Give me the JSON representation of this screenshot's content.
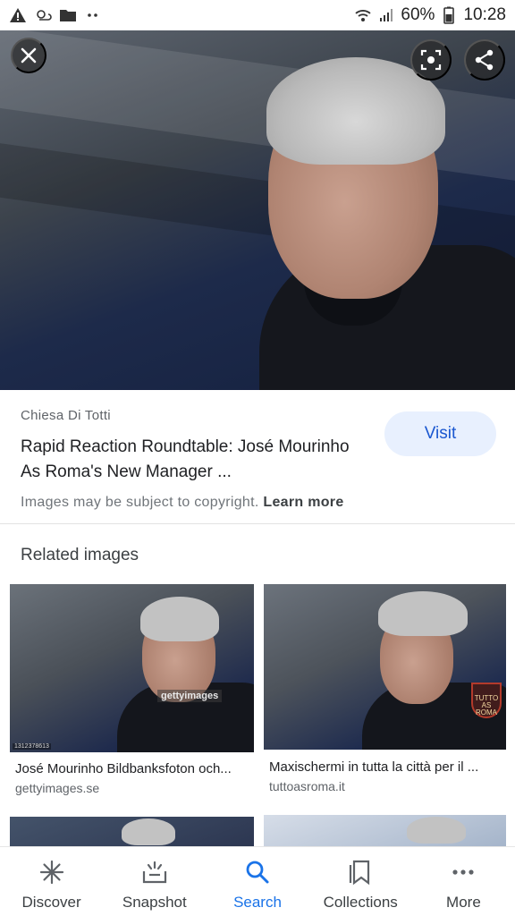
{
  "status_bar": {
    "battery": "60%",
    "time": "10:28"
  },
  "hero": {
    "close_icon": "close-icon",
    "lens_icon": "lens-icon",
    "share_icon": "share-icon"
  },
  "result": {
    "source": "Chiesa Di Totti",
    "title": "Rapid Reaction Roundtable: José Mourinho As Roma's New Manager ...",
    "visit_label": "Visit",
    "copyright_text": "Images may be subject to copyright.",
    "learn_more": "Learn more"
  },
  "related": {
    "heading": "Related images",
    "items": [
      {
        "caption": "José Mourinho Bildbanksfoton och...",
        "domain": "gettyimages.se",
        "watermark": "gettyimages",
        "image_id": "1312378613"
      },
      {
        "caption": "Maxischermi in tutta la città per il ...",
        "domain": "tuttoasroma.it",
        "logo_text": "TUTTO AS ROMA"
      }
    ]
  },
  "bottom_nav": {
    "items": [
      {
        "label": "Discover",
        "icon": "asterisk-icon"
      },
      {
        "label": "Snapshot",
        "icon": "snapshot-icon"
      },
      {
        "label": "Search",
        "icon": "search-icon",
        "active": true
      },
      {
        "label": "Collections",
        "icon": "bookmarks-icon"
      },
      {
        "label": "More",
        "icon": "more-dots-icon"
      }
    ]
  },
  "colors": {
    "accent": "#1a73e8",
    "visit_bg": "#e8f0fe",
    "visit_text": "#1a57d0"
  }
}
